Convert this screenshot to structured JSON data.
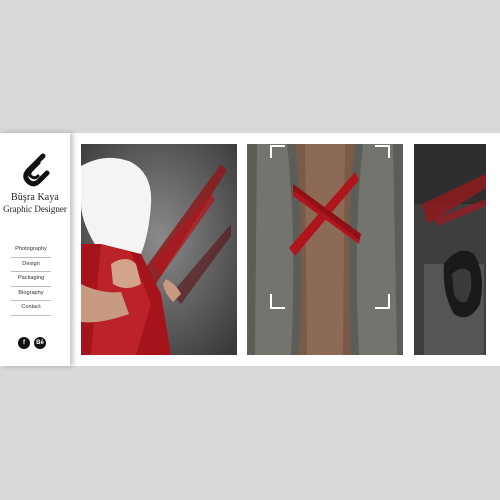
{
  "brand": {
    "name": "Büşra Kaya",
    "title": "Graphic Designer"
  },
  "nav": {
    "items": [
      {
        "label": "Photography"
      },
      {
        "label": "Design"
      },
      {
        "label": "Packaging"
      },
      {
        "label": "Biography"
      },
      {
        "label": "Contact"
      }
    ]
  },
  "social": {
    "facebook": {
      "icon": "facebook-icon",
      "glyph": "f"
    },
    "behance": {
      "icon": "behance-icon",
      "glyph": "Bē"
    }
  },
  "gallery": {
    "images": [
      {
        "subject": "figure with white cloth over head, red stained garment, red brush strokes"
      },
      {
        "subject": "torso with red tape cross under open grey shirt, focus frame corners"
      },
      {
        "subject": "dark grunge texture with red streak and crumpled dark form"
      }
    ]
  },
  "colors": {
    "page_bg": "#d9d9d9",
    "site_bg": "#ffffff",
    "accent_red": "#b0141c",
    "text": "#222222"
  }
}
